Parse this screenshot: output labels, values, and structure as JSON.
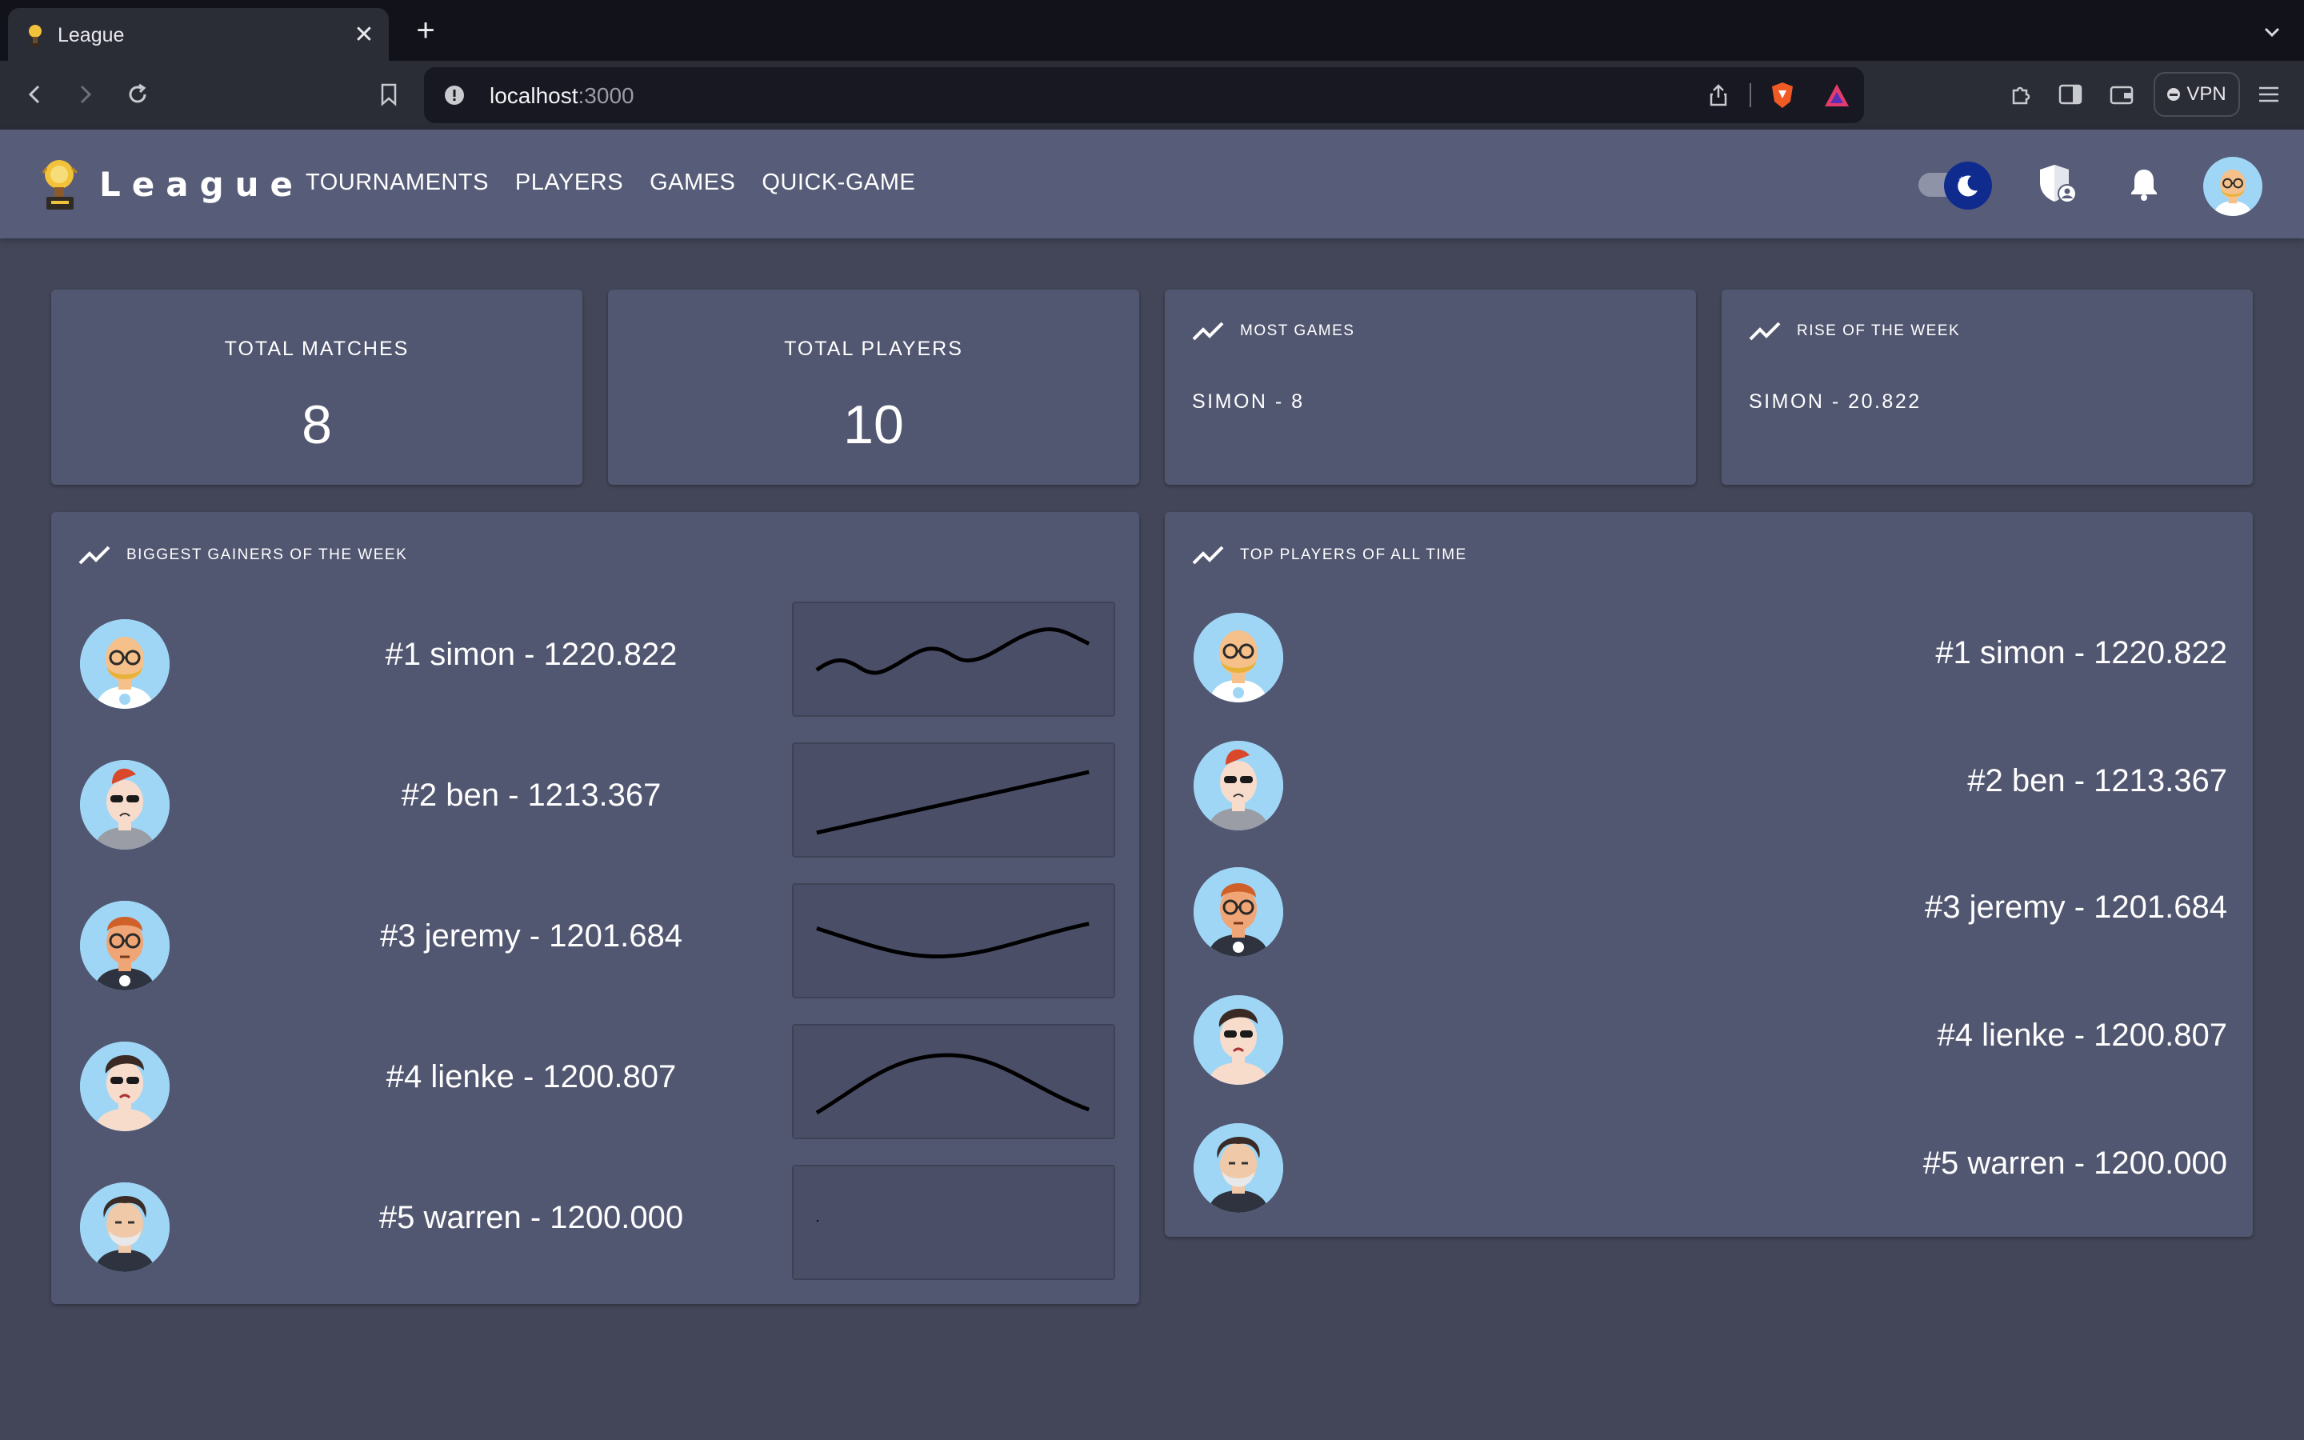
{
  "browser": {
    "tab_title": "League",
    "url_host": "localhost",
    "url_port": ":3000",
    "vpn_label": "VPN"
  },
  "app": {
    "brand": "League",
    "nav": [
      "TOURNAMENTS",
      "PLAYERS",
      "GAMES",
      "QUICK-GAME"
    ],
    "theme_mode": "dark"
  },
  "stats": {
    "total_matches_label": "TOTAL MATCHES",
    "total_matches_value": "8",
    "total_players_label": "TOTAL PLAYERS",
    "total_players_value": "10",
    "most_games_label": "MOST GAMES",
    "most_games_value": "SIMON - 8",
    "rise_label": "RISE OF THE WEEK",
    "rise_value": "SIMON - 20.822"
  },
  "gainers": {
    "title": "BIGGEST GAINERS OF THE WEEK",
    "rows": [
      {
        "text": "#1 simon - 1220.822",
        "avatar": "bald-glasses-avatar"
      },
      {
        "text": "#2 ben - 1213.367",
        "avatar": "redhair-sunglasses-avatar"
      },
      {
        "text": "#3 jeremy - 1201.684",
        "avatar": "ginger-glasses-avatar"
      },
      {
        "text": "#4 lienke - 1200.807",
        "avatar": "dark-hair-sunglasses-avatar"
      },
      {
        "text": "#5 warren - 1200.000",
        "avatar": "curly-beard-avatar"
      }
    ]
  },
  "top_players": {
    "title": "TOP PLAYERS OF ALL TIME",
    "rows": [
      {
        "text": "#1 simon - 1220.822",
        "avatar": "bald-glasses-avatar"
      },
      {
        "text": "#2 ben - 1213.367",
        "avatar": "redhair-sunglasses-avatar"
      },
      {
        "text": "#3 jeremy - 1201.684",
        "avatar": "ginger-glasses-avatar"
      },
      {
        "text": "#4 lienke - 1200.807",
        "avatar": "dark-hair-sunglasses-avatar"
      },
      {
        "text": "#5 warren - 1200.000",
        "avatar": "curly-beard-avatar"
      }
    ]
  },
  "colors": {
    "page_bg": "#424658",
    "appbar_bg": "#575c78",
    "card_bg": "#525771",
    "toggle_thumb": "#0f2b8e"
  }
}
